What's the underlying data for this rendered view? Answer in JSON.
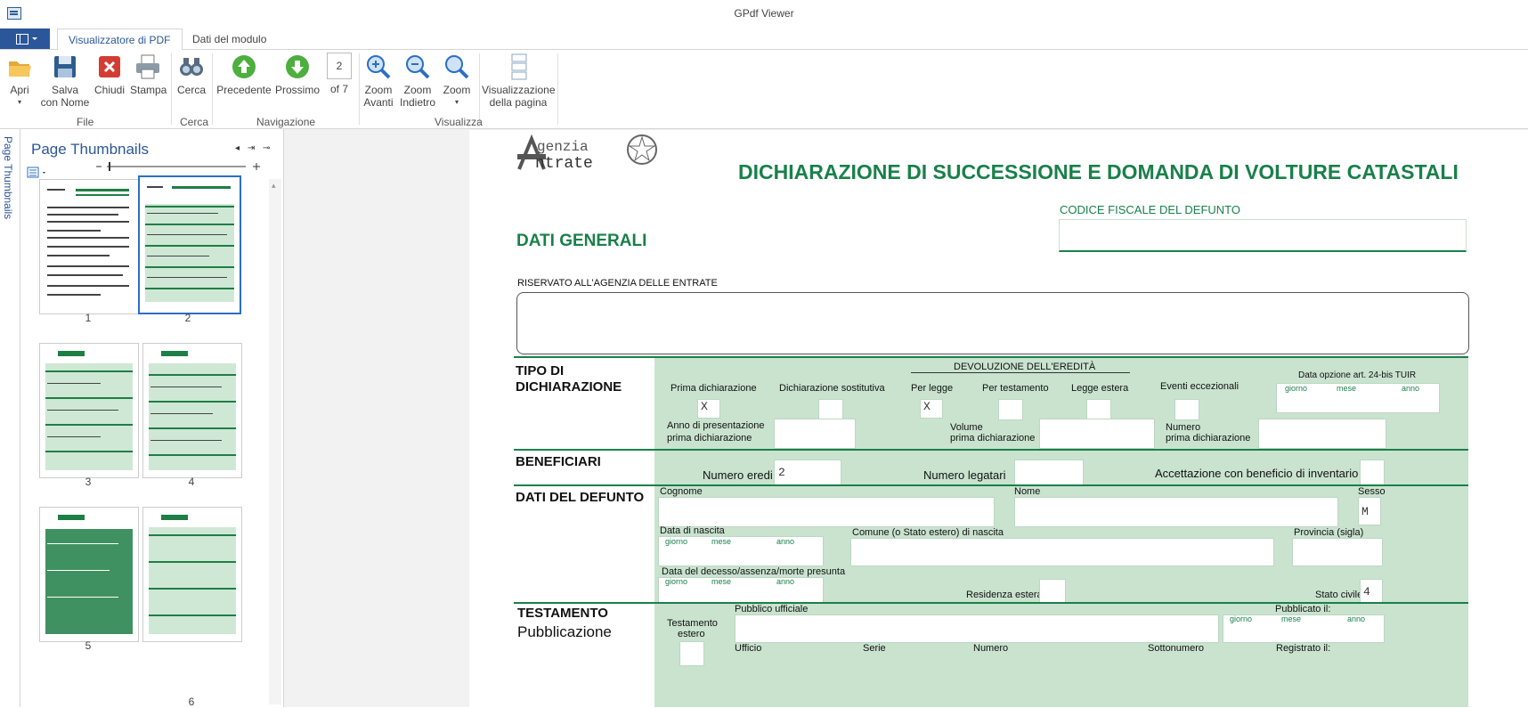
{
  "window": {
    "title": "GPdf Viewer"
  },
  "tabs": [
    {
      "label": "Visualizzatore di PDF"
    },
    {
      "label": "Dati del modulo"
    }
  ],
  "ribbon": {
    "file": {
      "group": "File",
      "open": "Apri",
      "save_as_1": "Salva",
      "save_as_2": "con Nome",
      "close": "Chiudi",
      "print": "Stampa"
    },
    "find": {
      "group": "Cerca",
      "find": "Cerca"
    },
    "nav": {
      "group": "Navigazione",
      "prev": "Precedente",
      "next": "Prossimo",
      "page": "2",
      "of": "of 7"
    },
    "view": {
      "group": "Visualizza",
      "zoom_in_1": "Zoom",
      "zoom_in_2": "Avanti",
      "zoom_out_1": "Zoom",
      "zoom_out_2": "Indietro",
      "zoom": "Zoom",
      "page_view_1": "Visualizzazione",
      "page_view_2": "della pagina"
    }
  },
  "sidebar": {
    "vertical_tab": "Page Thumbnails",
    "panel_title": "Page Thumbnails"
  },
  "thumbnails": [
    {
      "num": "1"
    },
    {
      "num": "2"
    },
    {
      "num": "3"
    },
    {
      "num": "4"
    },
    {
      "num": "5"
    },
    {
      "num": "6"
    }
  ],
  "document": {
    "logo_top": "genzia",
    "logo_bottom": "ntrate",
    "main_title": "DICHIARAZIONE DI SUCCESSIONE E DOMANDA DI VOLTURE CATASTALI",
    "cf_label": "CODICE FISCALE DEL DEFUNTO",
    "dati_generali": "DATI GENERALI",
    "riservato": "RISERVATO ALL'AGENZIA DELLE ENTRATE",
    "tipo_1": "TIPO DI",
    "tipo_2": "DICHIARAZIONE",
    "devoluzione": "DEVOLUZIONE DELL'EREDITÀ",
    "prima": "Prima dichiarazione",
    "sostitutiva": "Dichiarazione sostitutiva",
    "per_legge": "Per legge",
    "per_testamento": "Per testamento",
    "legge_estera": "Legge estera",
    "eventi": "Eventi eccezionali",
    "data_opzione": "Data opzione art. 24-bis TUIR",
    "giorno": "giorno",
    "mese": "mese",
    "anno": "anno",
    "prima_value": "X",
    "per_legge_value": "X",
    "anno_pres_1": "Anno di presentazione",
    "anno_pres_2": "prima dichiarazione",
    "volume_1": "Volume",
    "volume_2": "prima dichiarazione",
    "numero_1": "Numero",
    "numero_2": "prima dichiarazione",
    "beneficiari": "BENEFICIARI",
    "numero_eredi": "Numero eredi",
    "numero_eredi_value": "2",
    "numero_legatari": "Numero legatari",
    "accettazione": "Accettazione con beneficio di inventario",
    "dati_defunto": "DATI DEL DEFUNTO",
    "cognome": "Cognome",
    "nome": "Nome",
    "sesso": "Sesso",
    "sesso_value": "M",
    "data_nascita": "Data di nascita",
    "comune": "Comune (o Stato estero) di nascita",
    "provincia": "Provincia (sigla)",
    "data_decesso": "Data del decesso/assenza/morte presunta",
    "residenza": "Residenza estera",
    "stato_civile": "Stato civile",
    "stato_civile_value": "4",
    "testamento": "TESTAMENTO",
    "pubblicazione": "Pubblicazione",
    "testamento_estero_1": "Testamento",
    "testamento_estero_2": "estero",
    "pubblico_ufficiale": "Pubblico ufficiale",
    "pubblicato": "Pubblicato il:",
    "ufficio": "Ufficio",
    "serie": "Serie",
    "numero": "Numero",
    "sottonumero": "Sottonumero",
    "registrato": "Registrato il:"
  }
}
